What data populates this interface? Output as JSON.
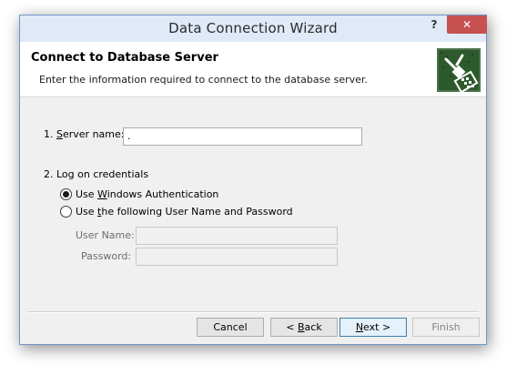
{
  "window": {
    "title": "Data Connection Wizard",
    "help_label": "?",
    "close_label": "✕"
  },
  "header": {
    "title": "Connect to Database Server",
    "description": "Enter the information required to connect to the database server.",
    "icon": "database-server-connect-icon"
  },
  "server": {
    "label_prefix": "1. ",
    "label_accel": "S",
    "label_rest": "erver name:",
    "value": "."
  },
  "credentials": {
    "label": "2. Log on credentials",
    "options": [
      {
        "pre": "Use ",
        "accel": "W",
        "post": "indows Authentication",
        "selected": true
      },
      {
        "pre": "Use ",
        "accel": "t",
        "post": "he following User Name and Password",
        "selected": false
      }
    ],
    "username_label": "User Name:",
    "username_value": "",
    "password_label": "Password:",
    "password_value": ""
  },
  "buttons": {
    "cancel": "Cancel",
    "back_pre": "< ",
    "back_accel": "B",
    "back_post": "ack",
    "next_accel": "N",
    "next_post": "ext >",
    "finish": "Finish"
  },
  "colors": {
    "close_button": "#c75050",
    "titlebar": "#dfe9f7",
    "icon_background": "#2d5a2d"
  }
}
